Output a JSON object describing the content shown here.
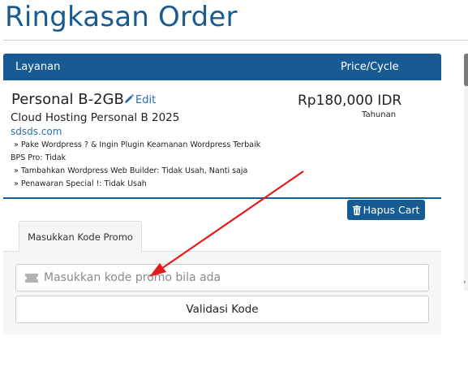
{
  "page": {
    "title": "Ringkasan Order"
  },
  "table": {
    "header_service": "Layanan",
    "header_price": "Price/Cycle"
  },
  "product": {
    "name": "Personal B-2GB",
    "edit_label": "Edit",
    "group": "Cloud Hosting Personal B 2025",
    "domain": "sdsds.com",
    "config_options": [
      "» Pake Wordpress ? & Ingin Plugin Keamanan Wordpress Terbaik",
      "BPS Pro: Tidak",
      "» Tambahkan Wordpress Web Builder: Tidak Usah, Nanti saja",
      "» Penawaran Special !: Tidak Usah"
    ],
    "price": "Rp180,000 IDR",
    "cycle": "Tahunan"
  },
  "cart": {
    "empty_label": "Hapus Cart"
  },
  "promo": {
    "tab_label": "Masukkan Kode Promo",
    "placeholder": "Masukkan kode promo bila ada",
    "value": "",
    "validate_label": "Validasi Kode"
  },
  "icons": {
    "edit": "pencil-icon",
    "empty_cart": "trash-icon",
    "promo": "ticket-icon",
    "annotation": "red-arrow"
  },
  "colors": {
    "primary": "#175b92",
    "link": "#2a6db2",
    "annotation": "#e31b1b"
  }
}
